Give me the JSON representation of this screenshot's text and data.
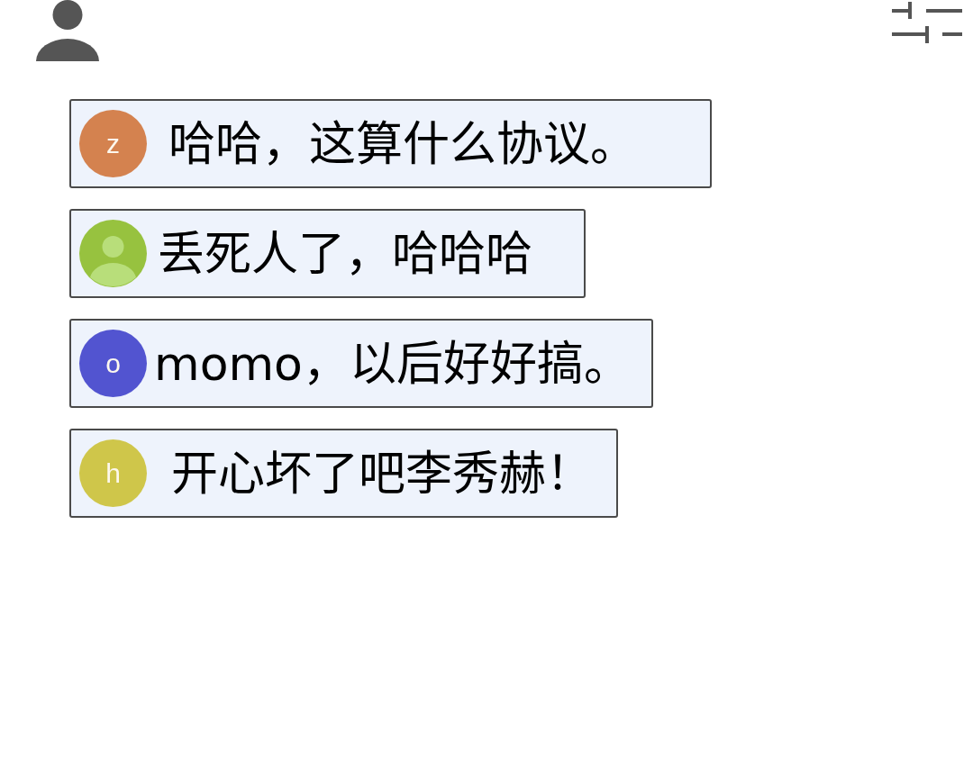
{
  "comments": [
    {
      "kind": "letter",
      "avatar_letter": "z",
      "color": "#d4824f",
      "text": "哈哈，这算什么协议。"
    },
    {
      "kind": "silhouette",
      "color": "#97c23f",
      "text": "丢死人了，哈哈哈"
    },
    {
      "kind": "letter",
      "avatar_letter": "o",
      "color": "#5254d0",
      "text": "momo，以后好好搞。"
    },
    {
      "kind": "letter",
      "avatar_letter": "h",
      "color": "#cfc64a",
      "text": "开心坏了吧李秀赫！"
    }
  ]
}
